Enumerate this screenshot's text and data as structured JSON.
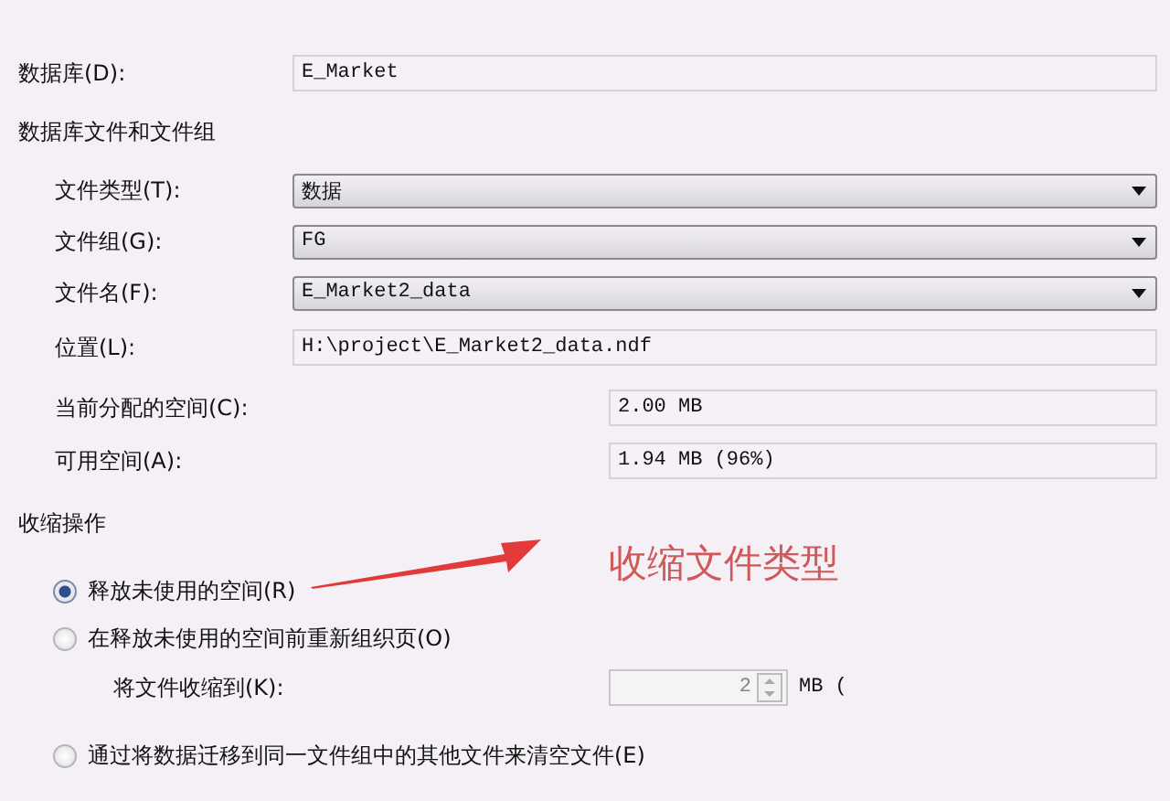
{
  "database": {
    "label": "数据库(D):",
    "value": "E_Market"
  },
  "files_section": {
    "title": "数据库文件和文件组",
    "fields": [
      {
        "kind": "dropdown",
        "label": "文件类型(T):",
        "value": "数据"
      },
      {
        "kind": "dropdown",
        "label": "文件组(G):",
        "value": "FG"
      },
      {
        "kind": "dropdown",
        "label": "文件名(F):",
        "value": "E_Market2_data"
      },
      {
        "kind": "text",
        "label": "位置(L):",
        "value": "H:\\project\\E_Market2_data.ndf"
      }
    ]
  },
  "space": [
    {
      "label": "当前分配的空间(C):",
      "value": "2.00 MB"
    },
    {
      "label": "可用空间(A):",
      "value": "1.94 MB (96%)"
    }
  ],
  "shrink": {
    "title": "收缩操作",
    "options": [
      {
        "label": "释放未使用的空间(R)",
        "selected": true
      },
      {
        "label": "在释放未使用的空间前重新组织页(O)",
        "selected": false,
        "shrink_to": {
          "label": "将文件收缩到(K):",
          "value": "2",
          "unit": "MB (",
          "disabled": true
        }
      },
      {
        "label": "通过将数据迁移到同一文件组中的其他文件来清空文件(E)",
        "selected": false
      }
    ]
  },
  "annotation": {
    "text": "收缩文件类型"
  }
}
